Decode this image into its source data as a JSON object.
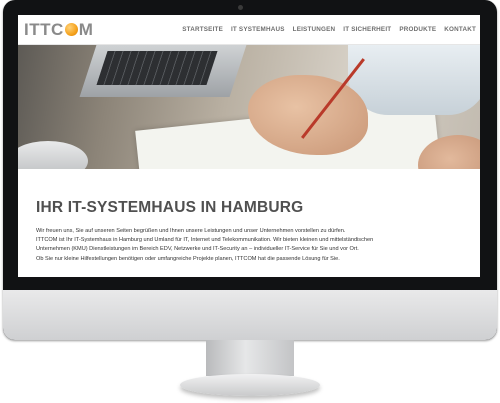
{
  "site": {
    "logo_text_left": "ITTC",
    "logo_text_right": "M",
    "nav": [
      "STARTSEITE",
      "IT SYSTEMHAUS",
      "LEISTUNGEN",
      "IT SICHERHEIT",
      "PRODUKTE",
      "KONTAKT"
    ]
  },
  "main": {
    "heading": "IHR IT-SYSTEMHAUS IN HAMBURG",
    "paragraphs": [
      "Wir freuen uns, Sie auf unseren Seiten begrüßen und Ihnen unsere Leistungen und unser Unternehmen vorstellen zu dürfen.",
      "ITTCOM ist Ihr IT-Systemhaus in Hamburg und Umland für IT, Internet und Telekommunikation. Wir bieten kleinen und mittelständischen",
      "Unternehmen (KMU) Dienstleistungen im Bereich EDV, Netzwerke und IT-Security an – individueller IT-Service für Sie und vor Ort.",
      "Ob Sie nur kleine Hilfestellungen benötigen oder umfangreiche Projekte planen, ITTCOM hat die passende Lösung für Sie."
    ]
  },
  "colors": {
    "logo_gray": "#8a8a8a",
    "globe_orange": "#f5a21c",
    "frame": "#111214"
  }
}
